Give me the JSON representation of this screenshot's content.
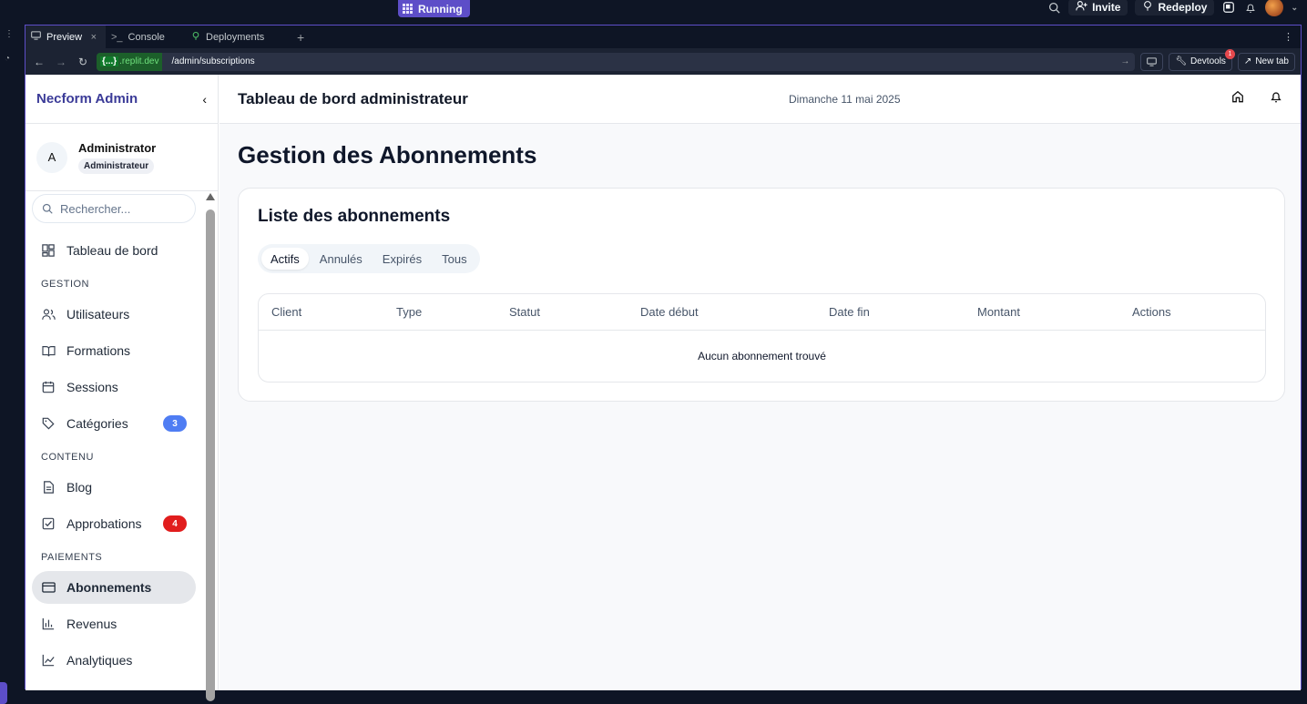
{
  "replit": {
    "status": "Running",
    "invite_label": "Invite",
    "redeploy_label": "Redeploy",
    "tabs": [
      {
        "label": "Preview",
        "icon": "monitor-icon"
      },
      {
        "label": "Console",
        "icon": "terminal-icon"
      },
      {
        "label": "Deployments",
        "icon": "deploy-icon"
      }
    ],
    "url_domain_prefix": "{...}",
    "url_domain": ".replit.dev",
    "url_path": "/admin/subscriptions",
    "devtools_label": "Devtools",
    "devtools_badge": "1",
    "new_tab_label": "New tab"
  },
  "sidebar": {
    "brand": "Necform Admin",
    "user_initial": "A",
    "user_name": "Administrator",
    "user_role": "Administrateur",
    "search_placeholder": "Rechercher...",
    "top_item": "Tableau de bord",
    "sections": [
      {
        "title": "GESTION",
        "items": [
          "Utilisateurs",
          "Formations",
          "Sessions",
          "Catégories"
        ]
      },
      {
        "title": "CONTENU",
        "items": [
          "Blog",
          "Approbations"
        ]
      },
      {
        "title": "PAIEMENTS",
        "items": [
          "Abonnements",
          "Revenus",
          "Analytiques"
        ]
      }
    ],
    "badges": {
      "categories": "3",
      "approbations": "4"
    },
    "badge_colors": {
      "blue": "#4f7df3",
      "red": "#e11d1d"
    }
  },
  "header": {
    "title": "Tableau de bord administrateur",
    "date": "Dimanche 11 mai 2025"
  },
  "page": {
    "title": "Gestion des Abonnements",
    "card_title": "Liste des abonnements",
    "filters": [
      "Actifs",
      "Annulés",
      "Expirés",
      "Tous"
    ],
    "columns": [
      "Client",
      "Type",
      "Statut",
      "Date début",
      "Date fin",
      "Montant",
      "Actions"
    ],
    "empty_message": "Aucun abonnement trouvé"
  }
}
